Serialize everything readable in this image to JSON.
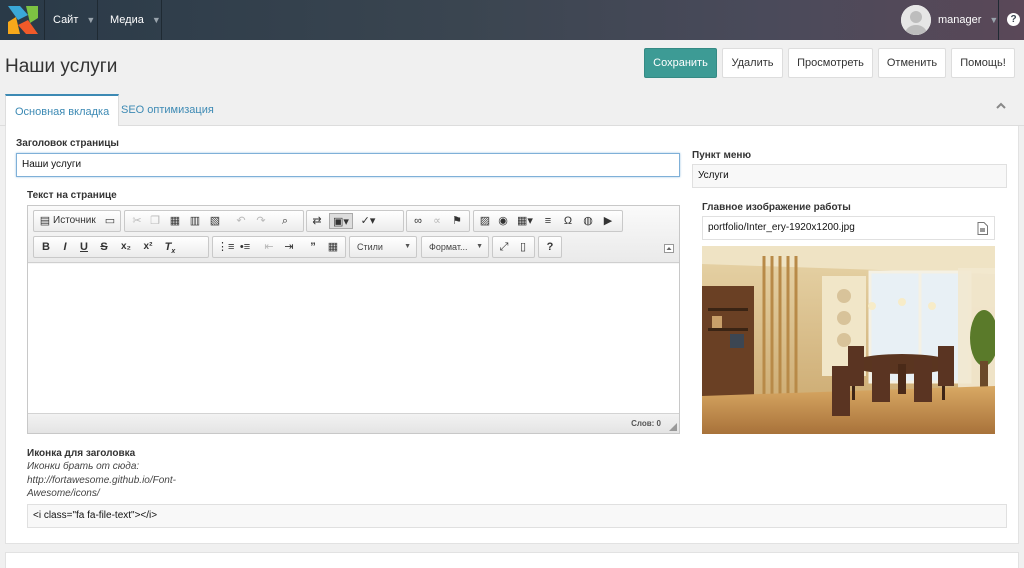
{
  "topbar": {
    "nav": [
      {
        "label": "Сайт"
      },
      {
        "label": "Медиа"
      }
    ],
    "user": {
      "name": "manager"
    },
    "help_label": "?"
  },
  "page": {
    "title": "Наши услуги"
  },
  "actions": {
    "save": "Сохранить",
    "delete": "Удалить",
    "view": "Просмотреть",
    "cancel": "Отменить",
    "help": "Помощь!"
  },
  "tabs": [
    {
      "label": "Основная вкладка",
      "active": true
    },
    {
      "label": "SEO оптимизация",
      "active": false
    }
  ],
  "form": {
    "page_title": {
      "label": "Заголовок страницы",
      "value": "Наши услуги"
    },
    "content": {
      "label": "Текст на странице",
      "word_count": "Слов: 0"
    },
    "menu_item": {
      "label": "Пункт меню",
      "value": "Услуги"
    },
    "main_image": {
      "label": "Главное изображение работы",
      "value": "portfolio/Inter_ery-1920x1200.jpg"
    },
    "heading_icon": {
      "label": "Иконка для заголовка",
      "hint": "Иконки брать от сюда: http://fortawesome.github.io/Font-Awesome/icons/",
      "value": "<i class=\"fa fa-file-text\"></i>"
    }
  },
  "editor_toolbar": {
    "source_label": "Источник",
    "styles_label": "Стили",
    "format_label": "Формат...",
    "help_label": "?"
  },
  "colors": {
    "accent": "#3d9b95",
    "link": "#3d8ab4",
    "topbar": "#3a4550"
  }
}
